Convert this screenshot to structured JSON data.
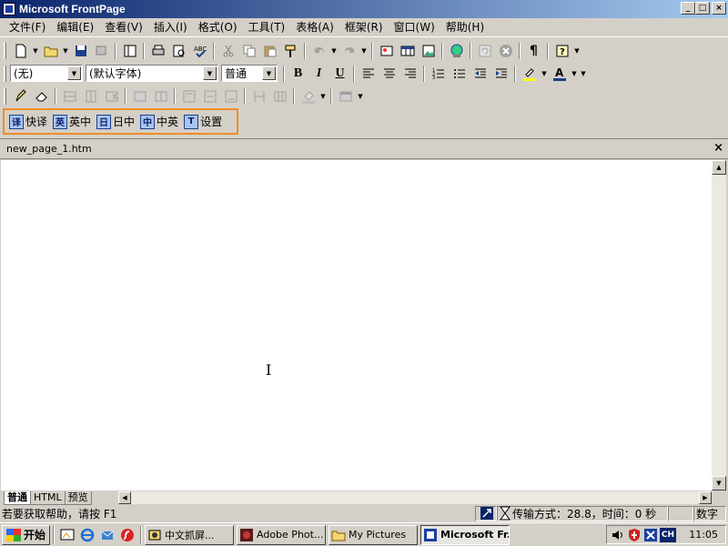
{
  "window": {
    "title": "Microsoft FrontPage",
    "min": "_",
    "max": "□",
    "close": "×"
  },
  "menu": [
    "文件(F)",
    "编辑(E)",
    "查看(V)",
    "插入(I)",
    "格式(O)",
    "工具(T)",
    "表格(A)",
    "框架(R)",
    "窗口(W)",
    "帮助(H)"
  ],
  "format_toolbar": {
    "style": "(无)",
    "font": "(默认字体)",
    "size": "普通",
    "bold": "B",
    "italic": "I",
    "underline": "U"
  },
  "translate_bar": {
    "items": [
      {
        "icon": "译",
        "label": "快译"
      },
      {
        "icon": "英",
        "label": "英中"
      },
      {
        "icon": "日",
        "label": "日中"
      },
      {
        "icon": "中",
        "label": "中英"
      },
      {
        "icon": "T",
        "label": "设置"
      }
    ]
  },
  "document": {
    "tab_label": "new_page_1.htm",
    "close": "×"
  },
  "view_tabs": [
    "普通",
    "HTML",
    "预览"
  ],
  "status": {
    "help": "若要获取帮助，请按 F1",
    "transfer": "传输方式：28.8，时间：0 秒",
    "numlock": "数字"
  },
  "taskbar": {
    "start": "开始",
    "tasks": [
      {
        "label": "中文抓屏...",
        "active": false
      },
      {
        "label": "Adobe Phot...",
        "active": false
      },
      {
        "label": "My Pictures",
        "active": false
      },
      {
        "label": "Microsoft Fr...",
        "active": true
      }
    ],
    "tray_lang": "CH",
    "clock": "11:05"
  },
  "colors": {
    "title_start": "#0a246a",
    "title_end": "#a6caf0",
    "highlight_border": "#f08c28",
    "face": "#d4d0c8"
  }
}
